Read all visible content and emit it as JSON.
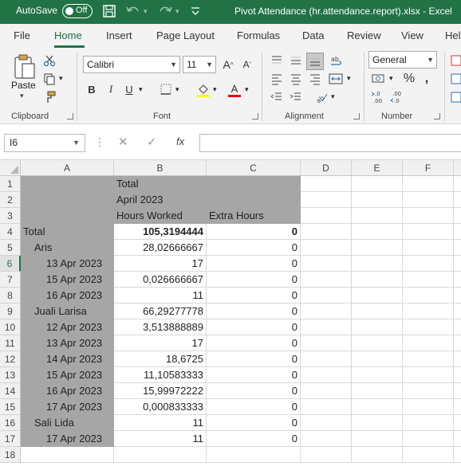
{
  "titlebar": {
    "autosave_label": "AutoSave",
    "autosave_state": "Off",
    "document_title": "Pivot Attendance (hr.attendance.report).xlsx  -  Excel"
  },
  "tabs": [
    "File",
    "Home",
    "Insert",
    "Page Layout",
    "Formulas",
    "Data",
    "Review",
    "View",
    "Hel"
  ],
  "active_tab": "Home",
  "ribbon": {
    "clipboard": {
      "label": "Clipboard",
      "paste": "Paste"
    },
    "font": {
      "label": "Font",
      "font_name": "Calibri",
      "font_size": "11"
    },
    "alignment": {
      "label": "Alignment"
    },
    "number": {
      "label": "Number",
      "format": "General"
    }
  },
  "formula_bar": {
    "name_box": "I6",
    "formula": "",
    "fx": "fx"
  },
  "colors": {
    "excel_green": "#217346",
    "pivot_gray": "#a6a6a6"
  },
  "columns": [
    "A",
    "B",
    "C",
    "D",
    "E",
    "F"
  ],
  "rows": [
    {
      "n": "1",
      "a": "",
      "b": "Total",
      "c": "",
      "style": "header"
    },
    {
      "n": "2",
      "a": "",
      "b": "April 2023",
      "c": "",
      "style": "header"
    },
    {
      "n": "3",
      "a": "",
      "b": "Hours Worked",
      "c": "Extra Hours",
      "style": "header"
    },
    {
      "n": "4",
      "a": "Total",
      "b": "105,3194444",
      "c": "0",
      "style": "total"
    },
    {
      "n": "5",
      "a": "Aris",
      "b": "28,02666667",
      "c": "0",
      "style": "l1"
    },
    {
      "n": "6",
      "a": "13 Apr 2023",
      "b": "17",
      "c": "0",
      "style": "l2"
    },
    {
      "n": "7",
      "a": "15 Apr 2023",
      "b": "0,026666667",
      "c": "0",
      "style": "l2"
    },
    {
      "n": "8",
      "a": "16 Apr 2023",
      "b": "11",
      "c": "0",
      "style": "l2"
    },
    {
      "n": "9",
      "a": "Juali Larisa",
      "b": "66,29277778",
      "c": "0",
      "style": "l1"
    },
    {
      "n": "10",
      "a": "12 Apr 2023",
      "b": "3,513888889",
      "c": "0",
      "style": "l2"
    },
    {
      "n": "11",
      "a": "13 Apr 2023",
      "b": "17",
      "c": "0",
      "style": "l2"
    },
    {
      "n": "12",
      "a": "14 Apr 2023",
      "b": "18,6725",
      "c": "0",
      "style": "l2"
    },
    {
      "n": "13",
      "a": "15 Apr 2023",
      "b": "11,10583333",
      "c": "0",
      "style": "l2"
    },
    {
      "n": "14",
      "a": "16 Apr 2023",
      "b": "15,99972222",
      "c": "0",
      "style": "l2"
    },
    {
      "n": "15",
      "a": "17 Apr 2023",
      "b": "0,000833333",
      "c": "0",
      "style": "l2"
    },
    {
      "n": "16",
      "a": "Sali Lida",
      "b": "11",
      "c": "0",
      "style": "l1"
    },
    {
      "n": "17",
      "a": "17 Apr 2023",
      "b": "11",
      "c": "0",
      "style": "l2"
    },
    {
      "n": "18",
      "a": "",
      "b": "",
      "c": "",
      "style": "empty"
    }
  ],
  "selected_row": "6"
}
